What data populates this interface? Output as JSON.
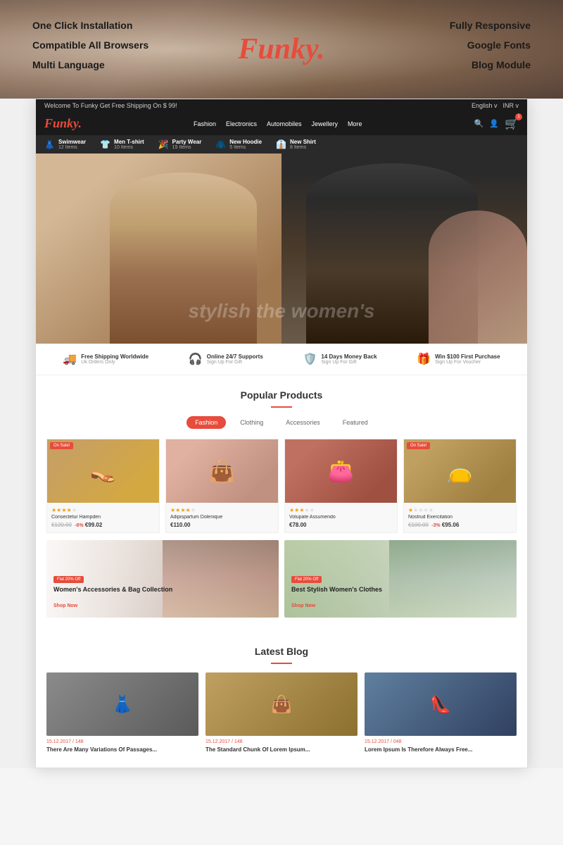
{
  "hero": {
    "left_features": [
      "One Click Installation",
      "Compatible All Browsers",
      "Multi Language"
    ],
    "right_features": [
      "Fully Responsive",
      "Google Fonts",
      "Blog Module"
    ],
    "logo": "Funky",
    "logo_dot": "."
  },
  "store": {
    "announce": "Welcome To Funky Get Free Shipping On $ 99!",
    "lang_options": [
      "English v",
      "INR v"
    ],
    "logo": "Funky",
    "logo_dot": ".",
    "nav_links": [
      "Fashion",
      "Electronics",
      "Automobiles",
      "Jewellery",
      "More"
    ],
    "categories": [
      {
        "icon": "👗",
        "name": "Swimwear",
        "count": "12 Items"
      },
      {
        "icon": "👕",
        "name": "Men T-shirt",
        "count": "10 Items"
      },
      {
        "icon": "🎉",
        "name": "Party Wear",
        "count": "15 Items"
      },
      {
        "icon": "🧥",
        "name": "New Hoodie",
        "count": "5 Items"
      },
      {
        "icon": "👔",
        "name": "New Shirt",
        "count": "8 Items"
      }
    ],
    "hero_text": "stylish the women's"
  },
  "services": [
    {
      "icon": "🚚",
      "title": "Free Shipping Worldwide",
      "subtitle": "Uk Orders Only"
    },
    {
      "icon": "🎧",
      "title": "Online 24/7 Supports",
      "subtitle": "Sign Up For Gift"
    },
    {
      "icon": "🛡️",
      "title": "14 Days Money Back",
      "subtitle": "Sign Up For Gift"
    },
    {
      "icon": "🎁",
      "title": "Win $100 First Purchase",
      "subtitle": "Sign Up For Voucher"
    }
  ],
  "popular_products": {
    "section_title": "Popular Products",
    "tabs": [
      "Fashion",
      "Clothing",
      "Accessories",
      "Featured"
    ],
    "active_tab": "Fashion",
    "products": [
      {
        "name": "Consectetur Hampden",
        "old_price": "€120.00",
        "price": "€99.02",
        "discount": "-6%",
        "stars": 4,
        "on_sale": true
      },
      {
        "name": "Adipispartum Dolenique",
        "price": "€110.00",
        "stars": 4,
        "on_sale": false
      },
      {
        "name": "Volupate Assumendo",
        "price": "€78.00",
        "stars": 3,
        "on_sale": false
      },
      {
        "name": "Nostrud Exercitation",
        "old_price": "€100.00",
        "price": "€95.06",
        "discount": "-3%",
        "stars": 1,
        "on_sale": true
      }
    ]
  },
  "promo_banners": [
    {
      "tag": "Flat 20% Off",
      "title": "Women's Accessories & Bag Collection",
      "link": "Shop Now"
    },
    {
      "tag": "Flat 20% Off",
      "title": "Best Stylish Women's Clothes",
      "link": "Shop Now"
    }
  ],
  "latest_blog": {
    "section_title": "Latest Blog",
    "posts": [
      {
        "date": "15.12.2017 / 148",
        "title": "There Are Many Variations Of Passages..."
      },
      {
        "date": "15.12.2017 / 148",
        "title": "The Standard Chunk Of Lorem Ipsum..."
      },
      {
        "date": "15.12.2017 / 048",
        "title": "Lorem Ipsum Is Therefore Always Free..."
      }
    ]
  }
}
